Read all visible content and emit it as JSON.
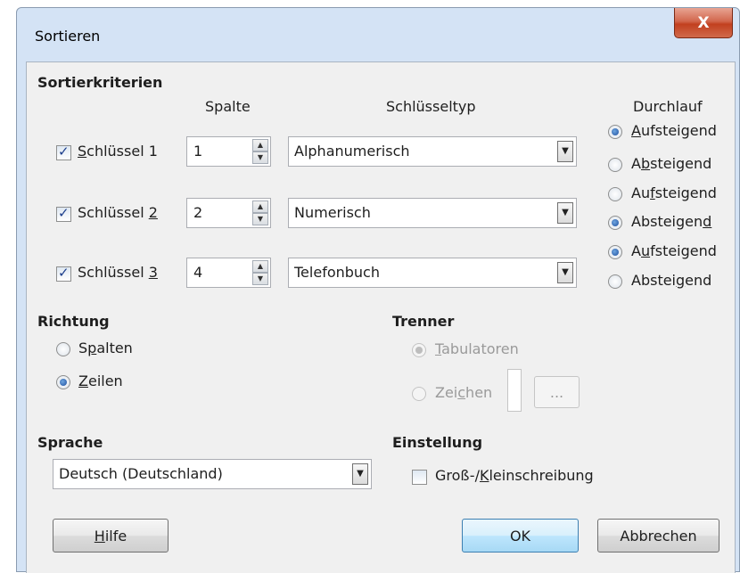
{
  "window": {
    "title": "Sortieren",
    "close_label": "X"
  },
  "sort_criteria": {
    "heading": "Sortierkriterien",
    "col_spalte": "Spalte",
    "col_type": "Schlüsseltyp",
    "col_direction": "Durchlauf",
    "keys": [
      {
        "label_pre": "",
        "label_u": "S",
        "label_post": "chlüssel 1",
        "checked": true,
        "column": "1",
        "type": "Alphanumerisch",
        "asc_pre": "",
        "asc_u": "A",
        "asc_post": "ufsteigend",
        "desc_pre": "A",
        "desc_u": "b",
        "desc_post": "steigend",
        "order": "asc"
      },
      {
        "label_pre": "Schlüssel ",
        "label_u": "2",
        "label_post": "",
        "checked": true,
        "column": "2",
        "type": "Numerisch",
        "asc_pre": "Au",
        "asc_u": "f",
        "asc_post": "steigend",
        "desc_pre": "Absteigen",
        "desc_u": "d",
        "desc_post": "",
        "order": "desc"
      },
      {
        "label_pre": "Schlüssel ",
        "label_u": "3",
        "label_post": "",
        "checked": true,
        "column": "4",
        "type": "Telefonbuch",
        "asc_pre": "A",
        "asc_u": "u",
        "asc_post": "fsteigend",
        "desc_pre": "Abstei",
        "desc_u": "g",
        "desc_post": "end",
        "order": "asc"
      }
    ]
  },
  "direction": {
    "heading": "Richtung",
    "columns_pre": "S",
    "columns_u": "p",
    "columns_post": "alten",
    "rows_pre": "",
    "rows_u": "Z",
    "rows_post": "eilen",
    "selected": "rows"
  },
  "separator": {
    "heading": "Trenner",
    "tabs_pre": "",
    "tabs_u": "T",
    "tabs_post": "abulatoren",
    "chars_pre": "Zei",
    "chars_u": "c",
    "chars_post": "hen",
    "ellipsis": "..."
  },
  "language": {
    "heading": "Sprache",
    "value": "Deutsch (Deutschland)"
  },
  "settings": {
    "heading": "Einstellung",
    "case_pre": "Groß-/",
    "case_u": "K",
    "case_post": "leinschreibung",
    "case_checked": false
  },
  "buttons": {
    "help_u": "H",
    "help_post": "ilfe",
    "ok": "OK",
    "cancel": "Abbrechen"
  }
}
